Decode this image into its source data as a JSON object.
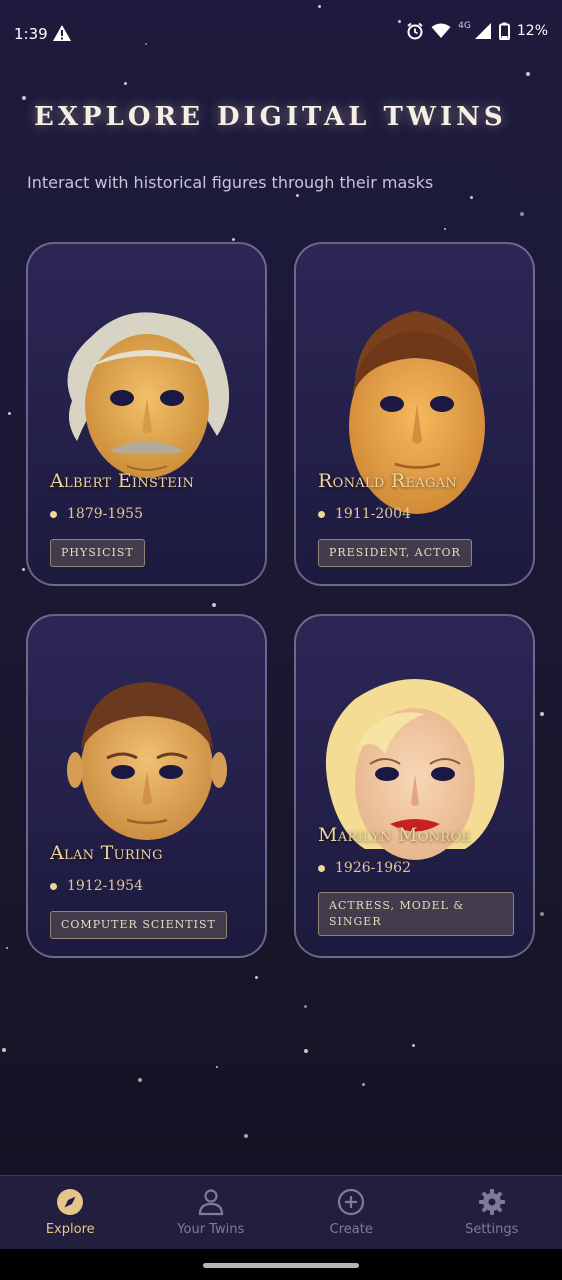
{
  "status_bar": {
    "time": "1:39",
    "network": "4G",
    "battery": "12%"
  },
  "header": {
    "title": "EXPLORE DIGITAL TWINS",
    "subtitle": "Interact with historical figures through their masks"
  },
  "cards": [
    {
      "name": "Albert Einstein",
      "dates": "1879-1955",
      "tag": "PHYSICIST"
    },
    {
      "name": "Ronald Reagan",
      "dates": "1911-2004",
      "tag": "PRESIDENT, ACTOR"
    },
    {
      "name": "Alan Turing",
      "dates": "1912-1954",
      "tag": "COMPUTER SCIENTIST"
    },
    {
      "name": "Marilyn Monroe",
      "dates": "1926-1962",
      "tag": "ACTRESS, MODEL & SINGER"
    }
  ],
  "bottom_nav": {
    "items": [
      {
        "label": "Explore",
        "icon": "compass-icon",
        "active": true
      },
      {
        "label": "Your Twins",
        "icon": "person-icon",
        "active": false
      },
      {
        "label": "Create",
        "icon": "plus-circle-icon",
        "active": false
      },
      {
        "label": "Settings",
        "icon": "gear-icon",
        "active": false
      }
    ]
  },
  "colors": {
    "accent_gold": "#f1d49b",
    "background": "#1d1a3d",
    "nav_background": "#221f3e",
    "inactive": "#7f7b96"
  }
}
